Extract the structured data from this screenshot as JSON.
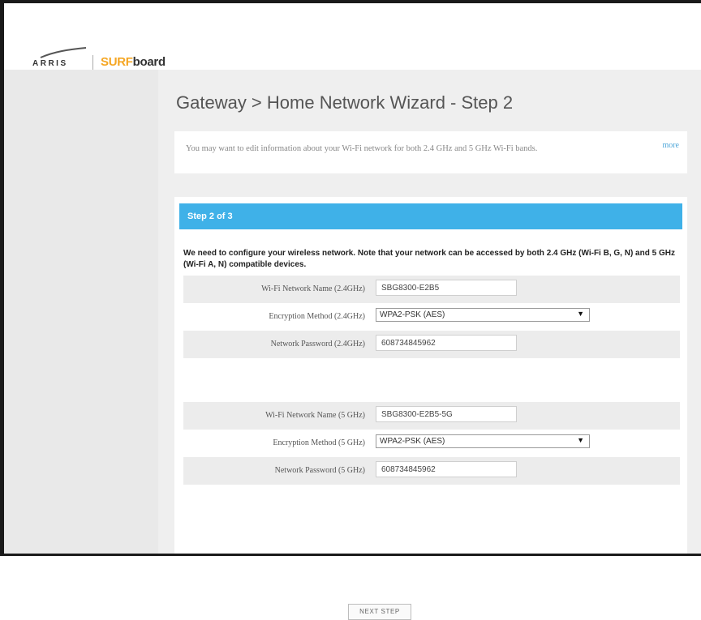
{
  "brand": {
    "arris": "ARRIS",
    "surfboard_accent": "SURF",
    "surfboard_rest": "board",
    "accent_color": "#f5a623"
  },
  "page": {
    "title": "Gateway > Home Network Wizard - Step 2"
  },
  "info": {
    "text": "You may want to edit information about your Wi-Fi network for both 2.4 GHz and 5 GHz Wi-Fi bands.",
    "link": "more"
  },
  "wizard": {
    "step_label": "Step 2 of 3",
    "step_bar_color": "#3fb1e8",
    "description": "We need to configure your wireless network. Note that your network can be accessed by both 2.4 GHz (Wi-Fi B, G, N) and 5 GHz (Wi-Fi A, N) compatible devices.",
    "band24": {
      "name_label": "Wi-Fi Network Name (2.4GHz)",
      "name_value": "SBG8300-E2B5",
      "enc_label": "Encryption Method (2.4GHz)",
      "enc_value": "WPA2-PSK (AES)",
      "pwd_label": "Network Password (2.4GHz)",
      "pwd_value": "608734845962"
    },
    "band5": {
      "name_label": "Wi-Fi Network Name (5 GHz)",
      "name_value": "SBG8300-E2B5-5G",
      "enc_label": "Encryption Method (5 GHz)",
      "enc_value": "WPA2-PSK (AES)",
      "pwd_label": "Network Password (5 GHz)",
      "pwd_value": "608734845962"
    },
    "next_button": "NEXT STEP"
  },
  "icons": {
    "dropdown": "dropdown-arrow-icon",
    "logo": "arris-swoosh-icon"
  }
}
